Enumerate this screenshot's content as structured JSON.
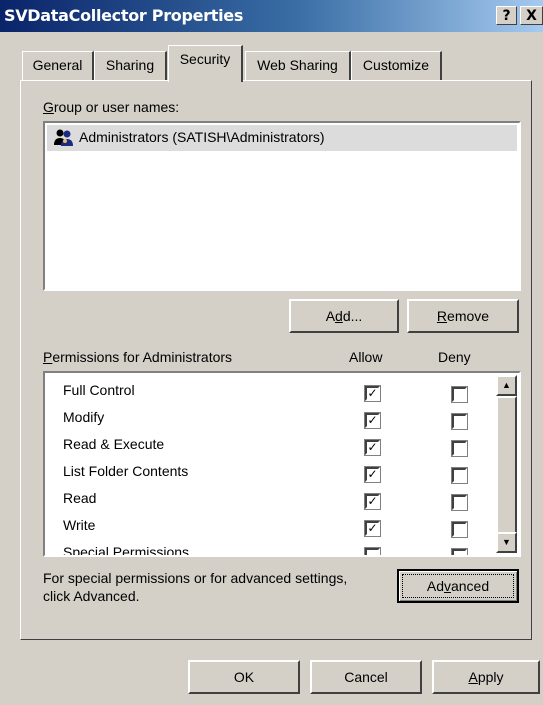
{
  "window": {
    "title": "SVDataCollector Properties",
    "help_glyph": "?",
    "close_glyph": "X"
  },
  "tabs": [
    {
      "label": "General"
    },
    {
      "label": "Sharing"
    },
    {
      "label": "Security",
      "active": true
    },
    {
      "label": "Web Sharing"
    },
    {
      "label": "Customize"
    }
  ],
  "security": {
    "group_label_mnemonic": "G",
    "group_label_rest": "roup or user names:",
    "users": [
      {
        "name": "Administrators (SATISH\\Administrators)",
        "icon": "users-group-icon"
      }
    ],
    "add_pre": "A",
    "add_mnemonic": "d",
    "add_post": "d...",
    "remove_mnemonic": "R",
    "remove_rest": "emove",
    "permissions_mnemonic": "P",
    "permissions_rest": "ermissions for Administrators",
    "allow_header": "Allow",
    "deny_header": "Deny",
    "permissions": [
      {
        "name": "Full Control",
        "allow": true,
        "deny": false
      },
      {
        "name": "Modify",
        "allow": true,
        "deny": false
      },
      {
        "name": "Read & Execute",
        "allow": true,
        "deny": false
      },
      {
        "name": "List Folder Contents",
        "allow": true,
        "deny": false
      },
      {
        "name": "Read",
        "allow": true,
        "deny": false
      },
      {
        "name": "Write",
        "allow": true,
        "deny": false
      },
      {
        "name": "Special Permissions",
        "allow": false,
        "deny": false
      }
    ],
    "advanced_note_line1": "For special permissions or for advanced settings,",
    "advanced_note_line2": "click Advanced.",
    "advanced_pre": "Ad",
    "advanced_mnemonic": "v",
    "advanced_post": "anced"
  },
  "footer": {
    "ok": "OK",
    "cancel": "Cancel",
    "apply_mnemonic": "A",
    "apply_rest": "pply"
  },
  "colors": {
    "titlebar_start": "#0a246a",
    "titlebar_end": "#a6caf0",
    "face": "#d4d0c8",
    "selection": "#dcdcdc"
  }
}
